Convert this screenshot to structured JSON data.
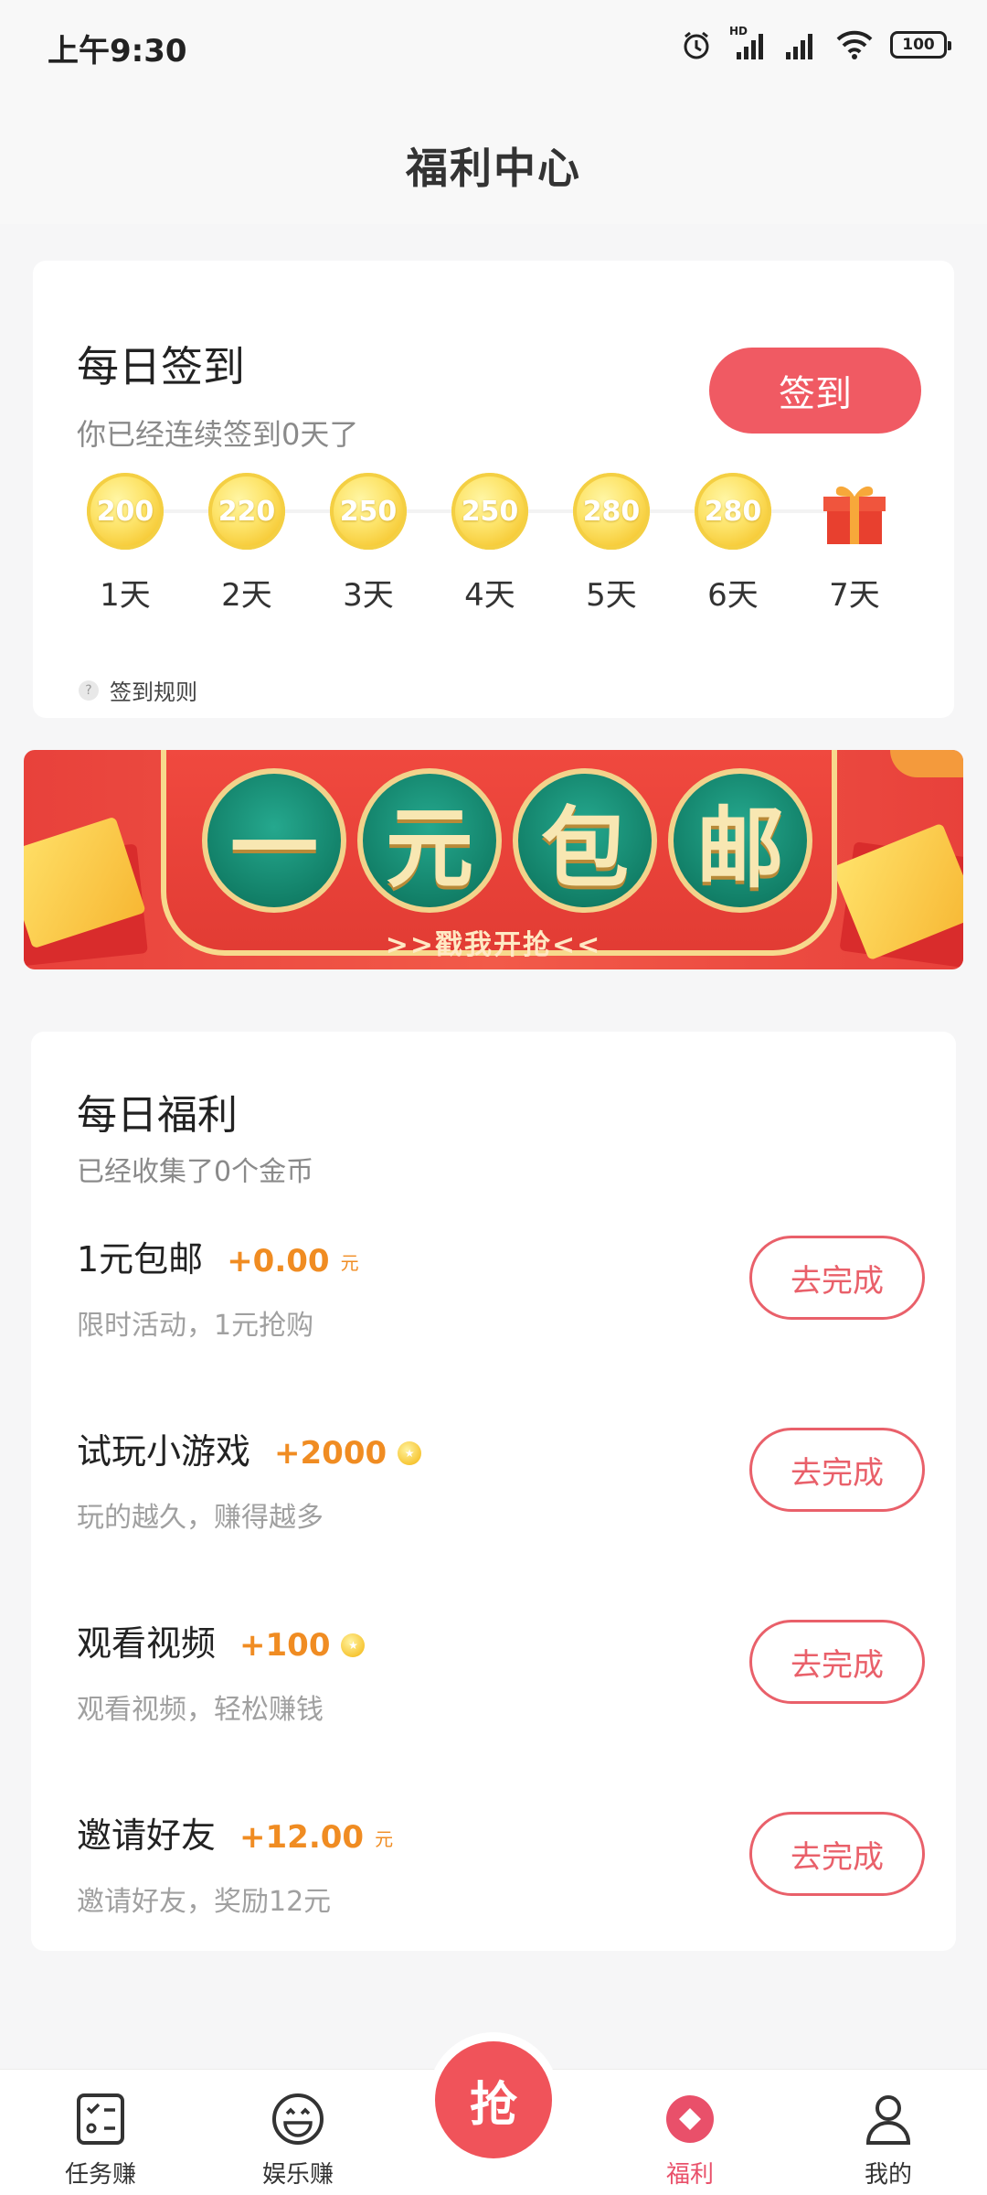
{
  "status_bar": {
    "time": "上午9:30",
    "battery": "100",
    "network_label": "HD"
  },
  "header": {
    "title": "福利中心"
  },
  "signin": {
    "title": "每日签到",
    "subtitle": "你已经连续签到0天了",
    "button_label": "签到",
    "days": [
      {
        "coins": "200",
        "label": "1天"
      },
      {
        "coins": "220",
        "label": "2天"
      },
      {
        "coins": "250",
        "label": "3天"
      },
      {
        "coins": "250",
        "label": "4天"
      },
      {
        "coins": "280",
        "label": "5天"
      },
      {
        "coins": "280",
        "label": "6天"
      },
      {
        "coins": "",
        "label": "7天",
        "icon": "gift-icon"
      }
    ],
    "rules_label": "签到规则"
  },
  "banner": {
    "chars": [
      "一",
      "元",
      "包",
      "邮"
    ],
    "subtitle": ">>戳我开抢<<"
  },
  "welfare": {
    "title": "每日福利",
    "subtitle": "已经收集了0个金币",
    "tasks": [
      {
        "name": "1元包邮",
        "reward": "+0.00",
        "unit": "元",
        "description": "限时活动，1元抢购",
        "button": "去完成"
      },
      {
        "name": "试玩小游戏",
        "reward": "+2000",
        "unit": "",
        "coin_icon": true,
        "description": "玩的越久，赚得越多",
        "button": "去完成"
      },
      {
        "name": "观看视频",
        "reward": "+100",
        "unit": "",
        "coin_icon": true,
        "description": "观看视频，轻松赚钱",
        "button": "去完成"
      },
      {
        "name": "邀请好友",
        "reward": "+12.00",
        "unit": "元",
        "description": "邀请好友，奖励12元",
        "button": "去完成"
      }
    ]
  },
  "tabbar": {
    "tabs": [
      {
        "label": "任务赚",
        "icon": "task-list-icon"
      },
      {
        "label": "娱乐赚",
        "icon": "smiley-icon"
      },
      {
        "label": "福利",
        "icon": "diamond-icon",
        "active": true
      },
      {
        "label": "我的",
        "icon": "user-icon"
      }
    ],
    "center_button": "抢"
  },
  "colors": {
    "accent": "#f05a63",
    "reward": "#f08c22",
    "active_tab": "#e9506a"
  }
}
